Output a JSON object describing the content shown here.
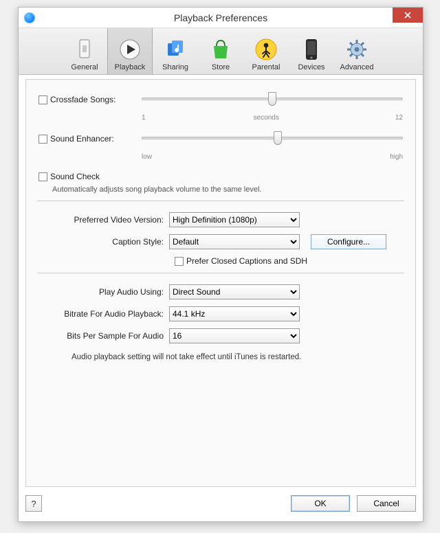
{
  "window": {
    "title": "Playback Preferences"
  },
  "tabs": [
    {
      "label": "General"
    },
    {
      "label": "Playback"
    },
    {
      "label": "Sharing"
    },
    {
      "label": "Store"
    },
    {
      "label": "Parental"
    },
    {
      "label": "Devices"
    },
    {
      "label": "Advanced"
    }
  ],
  "crossfade": {
    "label": "Crossfade Songs:",
    "left": "1",
    "center": "seconds",
    "right": "12",
    "thumb_percent": 50
  },
  "enhancer": {
    "label": "Sound Enhancer:",
    "left": "low",
    "right": "high",
    "thumb_percent": 52
  },
  "soundcheck": {
    "label": "Sound Check",
    "desc": "Automatically adjusts song playback volume to the same level."
  },
  "video": {
    "preferred_label": "Preferred Video Version:",
    "preferred_value": "High Definition (1080p)",
    "caption_label": "Caption Style:",
    "caption_value": "Default",
    "configure": "Configure...",
    "prefer_cc": "Prefer Closed Captions and SDH"
  },
  "audio": {
    "play_using_label": "Play Audio Using:",
    "play_using_value": "Direct Sound",
    "bitrate_label": "Bitrate For Audio Playback:",
    "bitrate_value": "44.1 kHz",
    "bits_label": "Bits Per Sample For Audio",
    "bits_value": "16",
    "note": "Audio playback setting will not take effect until iTunes is restarted."
  },
  "footer": {
    "help": "?",
    "ok": "OK",
    "cancel": "Cancel"
  }
}
